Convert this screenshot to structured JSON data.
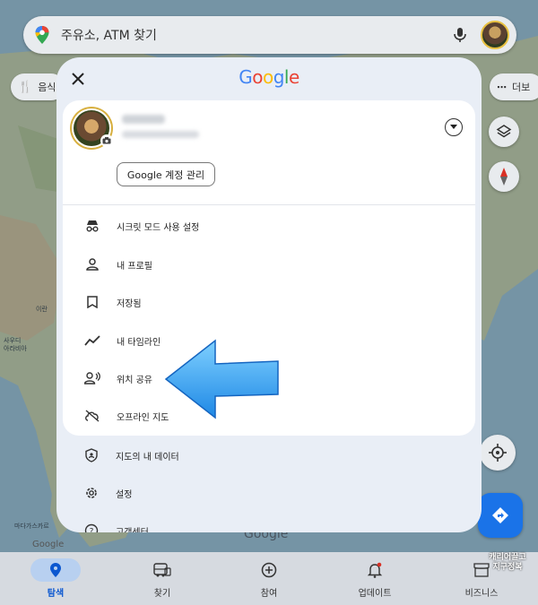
{
  "search": {
    "placeholder": "주유소, ATM 찾기"
  },
  "chips": {
    "left": "음식",
    "right": "더보"
  },
  "map_labels": {
    "iran": "이란",
    "saudi": "사우디\n아라비아",
    "madagascar": "마다가스카르",
    "google_wm": "Google",
    "google_wm2": "Google"
  },
  "modal": {
    "logo": "Google",
    "manage_account": "Google 계정 관리",
    "menu": [
      {
        "label": "시크릿 모드 사용 설정",
        "icon": "incognito-icon"
      },
      {
        "label": "내 프로필",
        "icon": "person-icon"
      },
      {
        "label": "저장됨",
        "icon": "bookmark-icon"
      },
      {
        "label": "내 타임라인",
        "icon": "timeline-icon"
      },
      {
        "label": "위치 공유",
        "icon": "location-sharing-icon"
      },
      {
        "label": "오프라인 지도",
        "icon": "cloud-off-icon"
      }
    ],
    "outer_menu": [
      {
        "label": "지도의 내 데이터",
        "icon": "shield-icon"
      },
      {
        "label": "설정",
        "icon": "gear-icon"
      },
      {
        "label": "고객센터",
        "icon": "help-icon"
      }
    ]
  },
  "bottom_nav": [
    {
      "label": "탐색",
      "icon": "location-pin-icon",
      "active": true
    },
    {
      "label": "찾기",
      "icon": "bus-icon",
      "active": false
    },
    {
      "label": "참여",
      "icon": "plus-circle-icon",
      "active": false
    },
    {
      "label": "업데이트",
      "icon": "bell-icon",
      "active": false
    },
    {
      "label": "비즈니스",
      "icon": "store-icon",
      "active": false
    }
  ],
  "watermark": "캐리어끌고\n지구정복",
  "colors": {
    "accent": "#0b57d0",
    "arrow": "#3aa8f0",
    "modal_bg": "#e9eef6"
  }
}
